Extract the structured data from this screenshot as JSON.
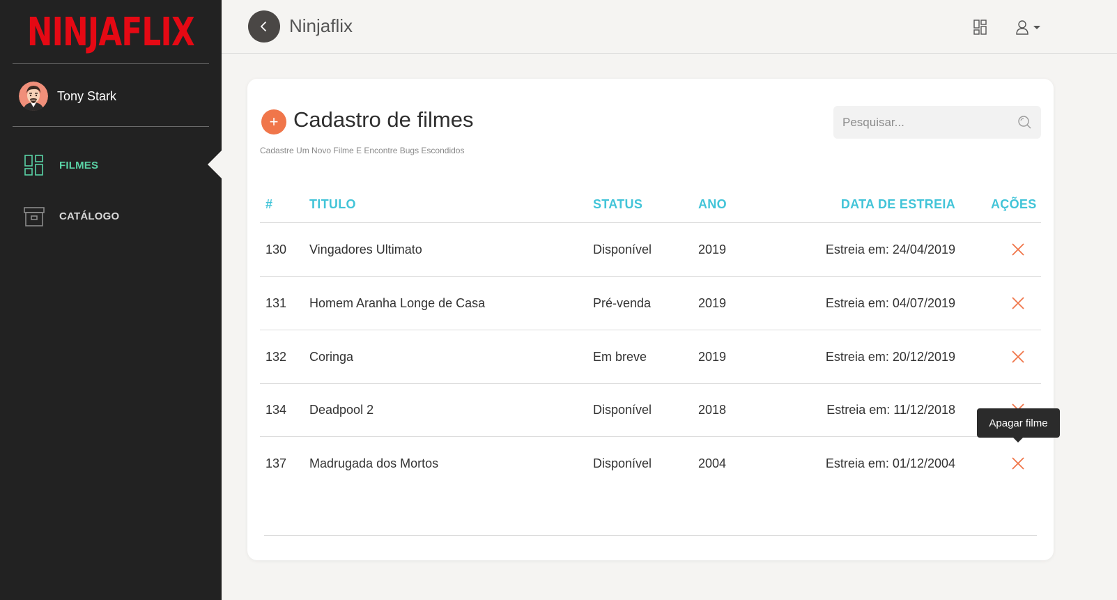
{
  "sidebar": {
    "logo_text": "NINJAFLIX",
    "user_name": "Tony Stark",
    "items": [
      {
        "label": "FILMES",
        "icon": "dashboard-icon",
        "active": true
      },
      {
        "label": "CATÁLOGO",
        "icon": "archive-box-icon",
        "active": false
      }
    ]
  },
  "topbar": {
    "title": "Ninjaflix",
    "back_icon": "chevron-left-icon",
    "layout_icon": "dashboard-icon",
    "user_icon": "user-icon"
  },
  "main": {
    "title": "Cadastro de filmes",
    "subtitle": "Cadastre Um Novo Filme E Encontre Bugs Escondidos",
    "search_placeholder": "Pesquisar...",
    "columns": {
      "id": "#",
      "title": "TITULO",
      "status": "STATUS",
      "year": "ANO",
      "release": "DATA DE ESTREIA",
      "actions": "AÇÕES"
    },
    "rows": [
      {
        "id": "130",
        "title": "Vingadores Ultimato",
        "status": "Disponível",
        "year": "2019",
        "release": "Estreia em: 24/04/2019"
      },
      {
        "id": "131",
        "title": "Homem Aranha Longe de Casa",
        "status": "Pré-venda",
        "year": "2019",
        "release": "Estreia em: 04/07/2019"
      },
      {
        "id": "132",
        "title": "Coringa",
        "status": "Em breve",
        "year": "2019",
        "release": "Estreia em: 20/12/2019"
      },
      {
        "id": "134",
        "title": "Deadpool 2",
        "status": "Disponível",
        "year": "2018",
        "release": "Estreia em: 11/12/2018"
      },
      {
        "id": "137",
        "title": "Madrugada dos Mortos",
        "status": "Disponível",
        "year": "2004",
        "release": "Estreia em: 01/12/2004"
      }
    ],
    "tooltip": "Apagar filme"
  },
  "colors": {
    "brand_red": "#e50914",
    "accent_green": "#5ad3a6",
    "header_cyan": "#42c4d8",
    "action_orange": "#f0764a",
    "sidebar_bg": "#222222"
  }
}
